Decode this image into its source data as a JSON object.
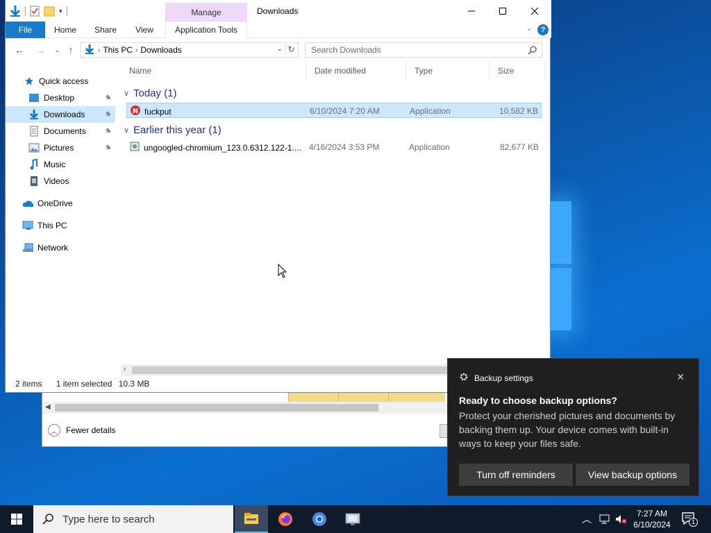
{
  "window": {
    "title": "Downloads",
    "manage_label": "Manage"
  },
  "ribbon": {
    "tabs": [
      "File",
      "Home",
      "Share",
      "View",
      "Application Tools"
    ],
    "help": "?"
  },
  "address": {
    "crumbs": [
      "This PC",
      "Downloads"
    ],
    "search_placeholder": "Search Downloads"
  },
  "nav": {
    "items": [
      {
        "label": "Quick access",
        "icon": "star-icon"
      },
      {
        "label": "Desktop",
        "icon": "desktop-folder-icon"
      },
      {
        "label": "Downloads",
        "icon": "download-arrow-icon"
      },
      {
        "label": "Documents",
        "icon": "documents-icon"
      },
      {
        "label": "Pictures",
        "icon": "pictures-icon"
      },
      {
        "label": "Music",
        "icon": "music-note-icon"
      },
      {
        "label": "Videos",
        "icon": "videos-icon"
      },
      {
        "label": "OneDrive",
        "icon": "cloud-icon"
      },
      {
        "label": "This PC",
        "icon": "monitor-icon"
      },
      {
        "label": "Network",
        "icon": "network-icon"
      }
    ]
  },
  "columns": [
    "Name",
    "Date modified",
    "Type",
    "Size"
  ],
  "groups": [
    {
      "label": "Today (1)",
      "files": [
        {
          "name": "fuckput",
          "date": "6/10/2024 7:20 AM",
          "type": "Application",
          "size": "10,582 KB",
          "icon": "red-n-app-icon"
        }
      ]
    },
    {
      "label": "Earlier this year (1)",
      "files": [
        {
          "name": "ungoogled-chromium_123.0.6312.122-1....",
          "date": "4/16/2024 3:53 PM",
          "type": "Application",
          "size": "82,677 KB",
          "icon": "installer-app-icon"
        }
      ]
    }
  ],
  "status": {
    "count": "2 items",
    "selection": "1 item selected",
    "size": "10.3 MB"
  },
  "bg_window": {
    "fewer_details": "Fewer details"
  },
  "toast": {
    "app": "Backup settings",
    "title": "Ready to choose backup options?",
    "body": "Protect your cherished pictures and documents by backing them up. Your device comes with built-in ways to keep your files safe.",
    "btn1": "Turn off reminders",
    "btn2": "View backup options"
  },
  "taskbar": {
    "search_placeholder": "Type here to search",
    "time": "7:27 AM",
    "date": "6/10/2024",
    "notif_count": "1"
  },
  "colors": {
    "accent": "#1979ca",
    "selection": "#cce8ff",
    "group_text": "#1e3287",
    "toast_bg": "#1f1f1f",
    "taskbar_bg": "#0f1a2b"
  }
}
